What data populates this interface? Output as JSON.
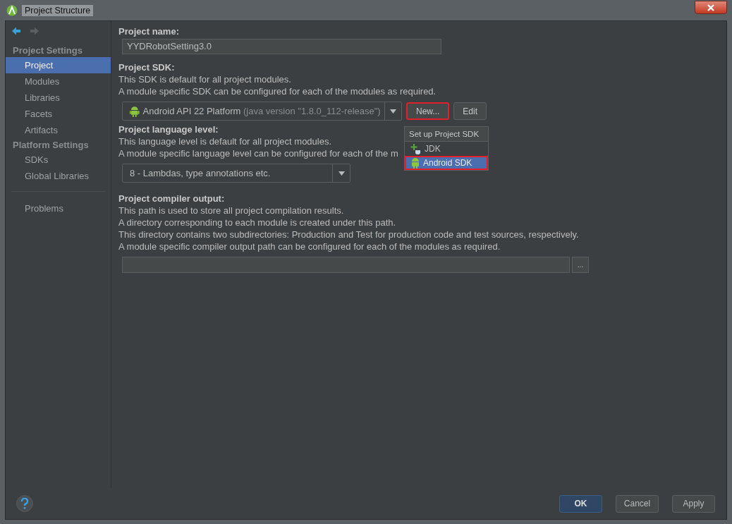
{
  "window": {
    "title": "Project Structure"
  },
  "sidebar": {
    "items": [
      {
        "kind": "header",
        "label": "Project Settings"
      },
      {
        "kind": "item",
        "label": "Project",
        "selected": true
      },
      {
        "kind": "item",
        "label": "Modules",
        "selected": false
      },
      {
        "kind": "item",
        "label": "Libraries",
        "selected": false
      },
      {
        "kind": "item",
        "label": "Facets",
        "selected": false
      },
      {
        "kind": "item",
        "label": "Artifacts",
        "selected": false
      },
      {
        "kind": "header",
        "label": "Platform Settings"
      },
      {
        "kind": "item",
        "label": "SDKs",
        "selected": false
      },
      {
        "kind": "item",
        "label": "Global Libraries",
        "selected": false
      },
      {
        "kind": "separator"
      },
      {
        "kind": "item",
        "label": "Problems",
        "selected": false
      }
    ]
  },
  "project_name": {
    "label": "Project name:",
    "value": "YYDRobotSetting3.0"
  },
  "project_sdk": {
    "label": "Project SDK:",
    "description": [
      "This SDK is default for all project modules.",
      "A module specific SDK can be configured for each of the modules as required."
    ],
    "value": "Android API 22 Platform",
    "value_detail": "(java version \"1.8.0_112-release\")",
    "buttons": [
      {
        "label": "New...",
        "highlighted": true
      },
      {
        "label": "Edit",
        "highlighted": false
      }
    ]
  },
  "popup": {
    "title": "Set up Project SDK",
    "items": [
      {
        "kind": "jdk",
        "label": "JDK",
        "selected": false,
        "highlighted": false
      },
      {
        "kind": "android",
        "label": "Android SDK",
        "selected": true,
        "highlighted": true
      }
    ]
  },
  "language_level": {
    "label": "Project language level:",
    "description": [
      "This language level is default for all project modules.",
      "A module specific language level can be configured for each of the m"
    ],
    "value": "8 - Lambdas, type annotations etc."
  },
  "compiler_output": {
    "label": "Project compiler output:",
    "description": [
      "This path is used to store all project compilation results.",
      "A directory corresponding to each module is created under this path.",
      "This directory contains two subdirectories: Production and Test for production code and test sources, respectively.",
      "A module specific compiler output path can be configured for each of the modules as required."
    ],
    "browse": "..."
  },
  "buttons": [
    {
      "label": "OK",
      "primary": true
    },
    {
      "label": "Cancel",
      "primary": false
    },
    {
      "label": "Apply",
      "primary": false
    }
  ]
}
